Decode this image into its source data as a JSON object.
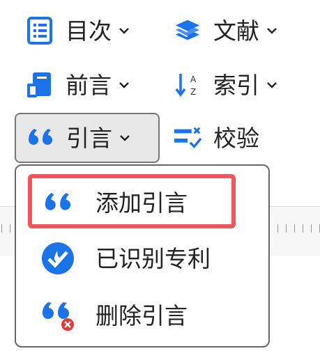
{
  "toolbar": {
    "items": [
      {
        "label": "目次",
        "icon": "table-of-contents-icon",
        "has_menu": true
      },
      {
        "label": "文献",
        "icon": "books-stack-icon",
        "has_menu": true
      },
      {
        "label": "前言",
        "icon": "book-page-icon",
        "has_menu": true
      },
      {
        "label": "索引",
        "icon": "sort-a-z-icon",
        "has_menu": true
      },
      {
        "label": "引言",
        "icon": "quote-icon",
        "has_menu": true,
        "active": true
      },
      {
        "label": "校验",
        "icon": "checklist-icon",
        "has_menu": false
      }
    ]
  },
  "citation_menu": {
    "items": [
      {
        "label": "添加引言",
        "icon": "quote-icon",
        "highlighted": true
      },
      {
        "label": "已识别专利",
        "icon": "patent-check-icon"
      },
      {
        "label": "删除引言",
        "icon": "quote-delete-icon"
      }
    ]
  },
  "colors": {
    "accent": "#1a73e8",
    "highlight": "#f2545b",
    "delete": "#e53935"
  }
}
